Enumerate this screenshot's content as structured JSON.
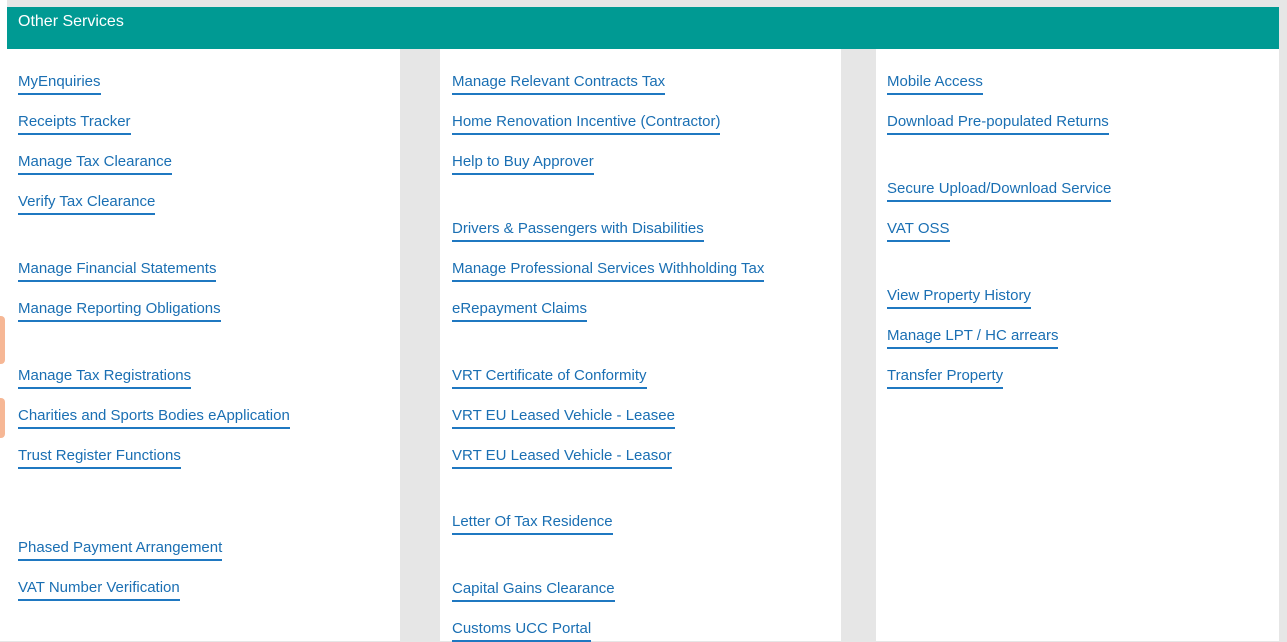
{
  "header": {
    "title": "Other Services"
  },
  "columns": [
    {
      "items": [
        "MyEnquiries",
        "Receipts Tracker",
        "Manage Tax Clearance",
        "Verify Tax Clearance",
        "Manage Financial Statements",
        "Manage Reporting Obligations",
        "Manage Tax Registrations",
        "Charities and Sports Bodies eApplication",
        "Trust Register Functions",
        "Phased Payment Arrangement",
        "VAT Number Verification"
      ]
    },
    {
      "items": [
        "Manage Relevant Contracts Tax",
        "Home Renovation Incentive (Contractor)",
        "Help to Buy Approver",
        "Drivers & Passengers with Disabilities",
        "Manage Professional Services Withholding Tax",
        "eRepayment Claims",
        "VRT Certificate of Conformity",
        "VRT EU Leased Vehicle - Leasee",
        "VRT EU Leased Vehicle - Leasor",
        "Letter Of Tax Residence",
        "Capital Gains Clearance",
        "Customs UCC Portal"
      ]
    },
    {
      "items": [
        "Mobile Access",
        "Download Pre-populated Returns",
        "Secure Upload/Download Service",
        "VAT OSS",
        "View Property History",
        "Manage LPT / HC arrears",
        "Transfer Property"
      ]
    }
  ],
  "colors": {
    "header_bg": "#009a93",
    "header_text": "#ffffff",
    "link": "#1a6fb3",
    "link_underline": "#1f78c1",
    "gutter": "#e6e6e6"
  }
}
